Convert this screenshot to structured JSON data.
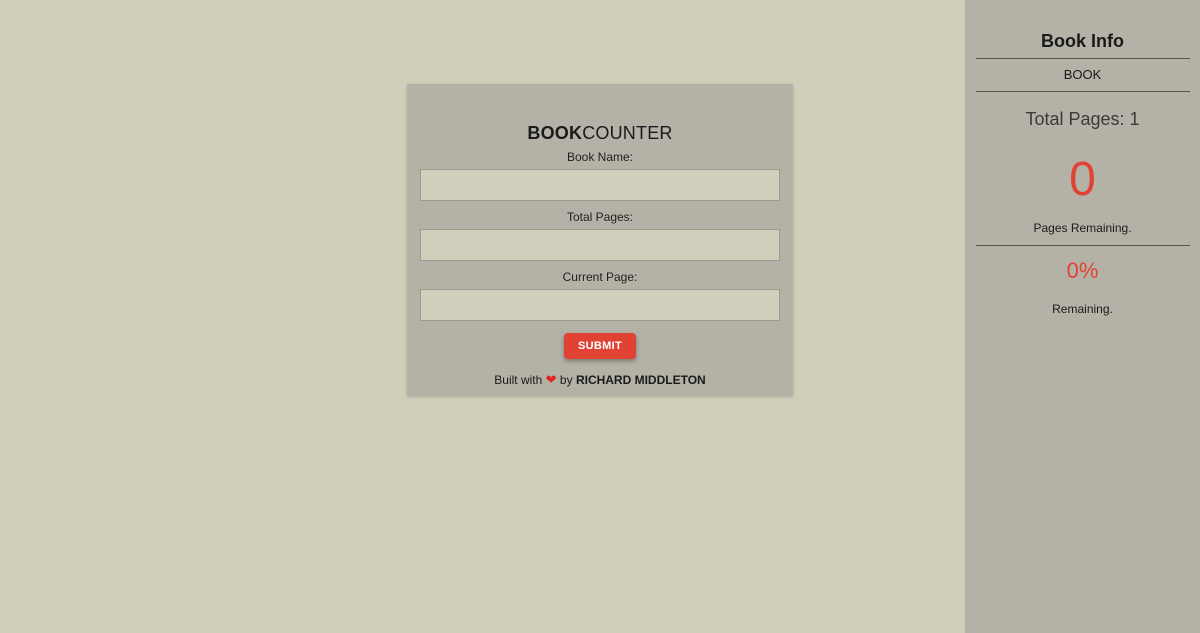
{
  "form": {
    "logo_bold": "BOOK",
    "logo_light": "COUNTER",
    "book_name_label": "Book Name:",
    "book_name_value": "",
    "total_pages_label": "Total Pages:",
    "total_pages_value": "",
    "current_page_label": "Current Page:",
    "current_page_value": "",
    "submit_label": "SUBMIT",
    "credit_prefix": "Built with",
    "credit_icon": "heart-icon",
    "credit_by": "by",
    "credit_author": "RICHARD MIDDLETON"
  },
  "sidebar": {
    "title": "Book Info",
    "book_name": "BOOK",
    "total_pages": "Total Pages: 1",
    "pages_remaining": "0",
    "pages_remaining_label": "Pages Remaining.",
    "percent_remaining": "0%",
    "percent_remaining_label": "Remaining."
  },
  "colors": {
    "background": "#d0cdb9",
    "panel": "#b4b2a6",
    "accent": "#e04234"
  }
}
